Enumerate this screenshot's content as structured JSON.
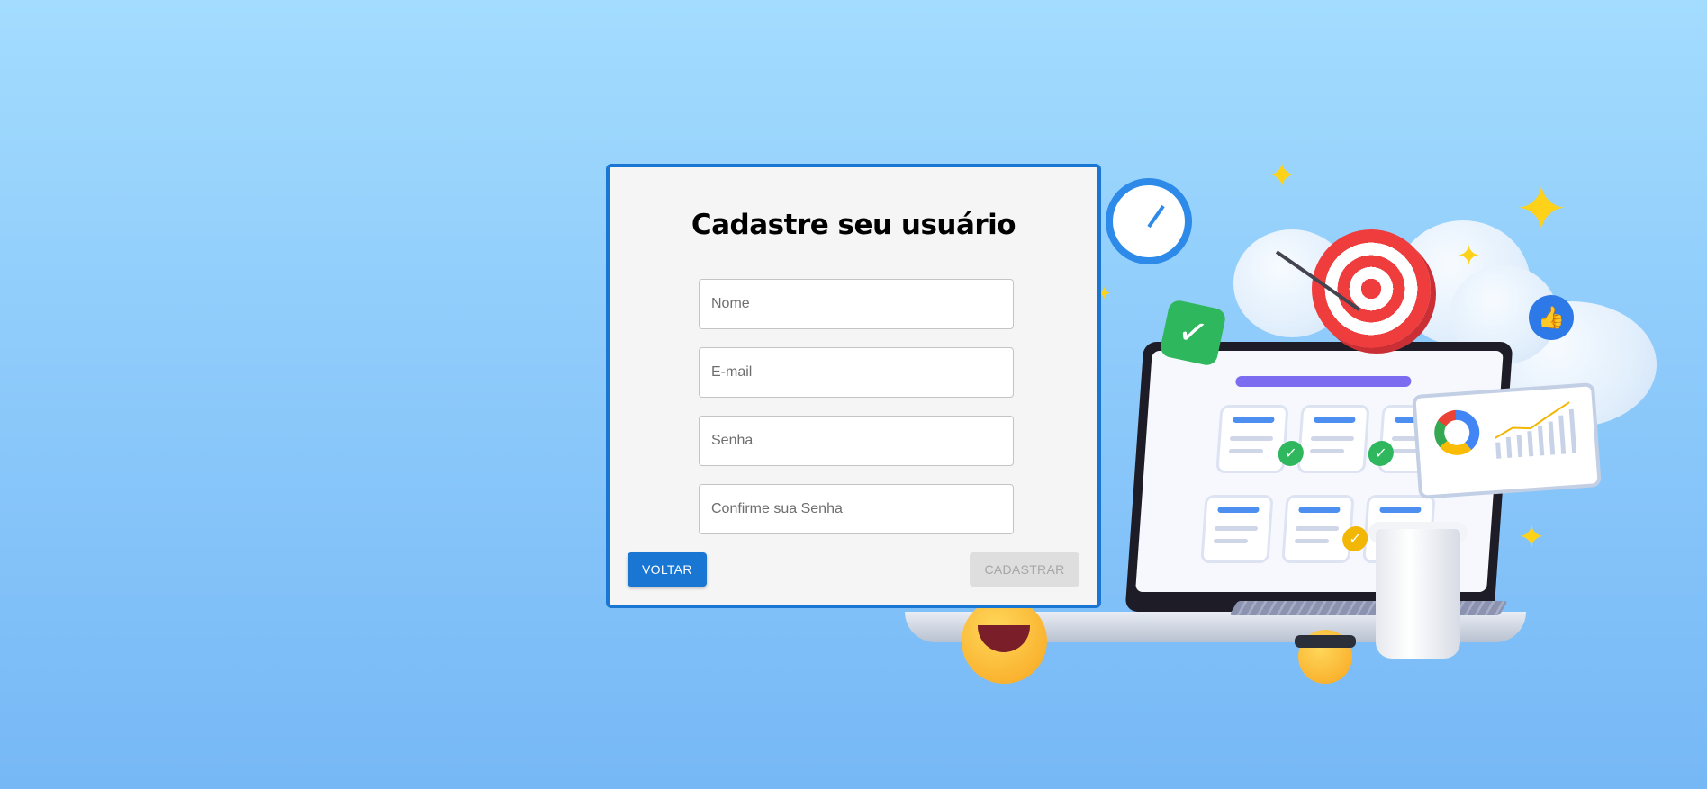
{
  "form": {
    "title": "Cadastre seu usuário",
    "fields": {
      "name": {
        "placeholder": "Nome",
        "value": ""
      },
      "email": {
        "placeholder": "E-mail",
        "value": ""
      },
      "password": {
        "placeholder": "Senha",
        "value": ""
      },
      "confirm_password": {
        "placeholder": "Confirme sua Senha",
        "value": ""
      }
    },
    "back_label": "VOLTAR",
    "submit_label": "CADASTRAR",
    "submit_disabled": true
  },
  "colors": {
    "accent": "#1976d2",
    "background_top": "#a3dcfe",
    "background_bottom": "#76b8f6",
    "card_background": "#f5f5f5",
    "disabled_button": "#dedede"
  },
  "illustration": {
    "icons": [
      "clock-icon",
      "target-icon",
      "check-icon",
      "thumbs-up-icon",
      "sparkle-icon",
      "coffee-cup-icon",
      "laughing-emoji-icon",
      "sunglasses-emoji-icon",
      "donut-chart-icon",
      "laptop-icon"
    ]
  }
}
